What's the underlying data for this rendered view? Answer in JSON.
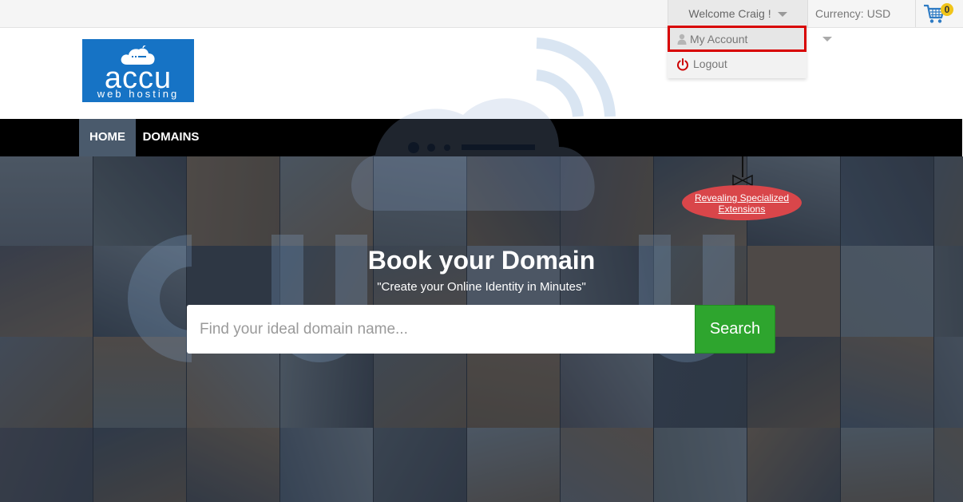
{
  "topbar": {
    "welcome": "Welcome Craig !",
    "currency_label": "Currency:",
    "currency_value": "USD",
    "cart_count": "0"
  },
  "account_menu": {
    "my_account": "My Account",
    "logout": "Logout"
  },
  "logo": {
    "word": "accu",
    "sub": "web hosting"
  },
  "nav": {
    "items": [
      {
        "label": "HOME",
        "active": true
      },
      {
        "label": "DOMAINS",
        "active": false
      }
    ]
  },
  "hero": {
    "title": "Book your Domain",
    "subtitle": "\"Create your Online Identity in Minutes\"",
    "search_placeholder": "Find your ideal domain name...",
    "search_button": "Search"
  },
  "promo": {
    "text": "Revealing Specialized Extensions"
  },
  "colors": {
    "brand_blue": "#1673c5",
    "nav_active": "#4a5a6c",
    "search_green": "#2ea52e",
    "promo_red": "#d9464a",
    "highlight_red": "#d80000",
    "cart_badge": "#f0c419"
  },
  "icons": [
    "user-icon",
    "power-icon",
    "cart-icon",
    "cloud-icon",
    "chevron-down-icon"
  ]
}
